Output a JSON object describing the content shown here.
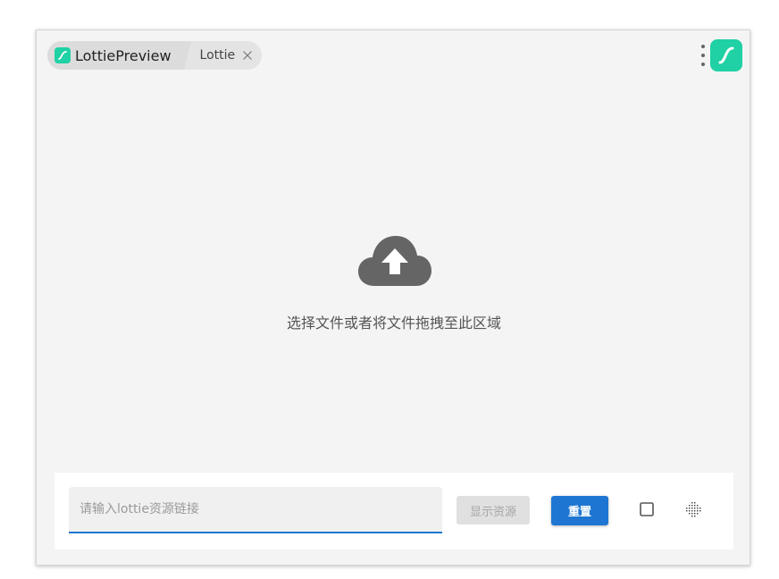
{
  "breadcrumb": {
    "app_name": "LottiePreview",
    "tab_label": "Lottie",
    "close_icon": "close-icon"
  },
  "header": {
    "menu_icon": "more-vertical-icon",
    "logo_icon": "lottie-logo-icon"
  },
  "dropzone": {
    "icon": "cloud-upload-icon",
    "text": "选择文件或者将文件拖拽至此区域"
  },
  "toolbar": {
    "url_placeholder": "请输入lottie资源链接",
    "url_value": "",
    "show_label": "显示资源",
    "reset_label": "重置",
    "square_icon": "checkbox-square-icon",
    "grid_icon": "dotted-grid-icon"
  },
  "colors": {
    "accent": "#1e76d2",
    "brand": "#1fd1a4",
    "background": "#f4f4f4"
  }
}
